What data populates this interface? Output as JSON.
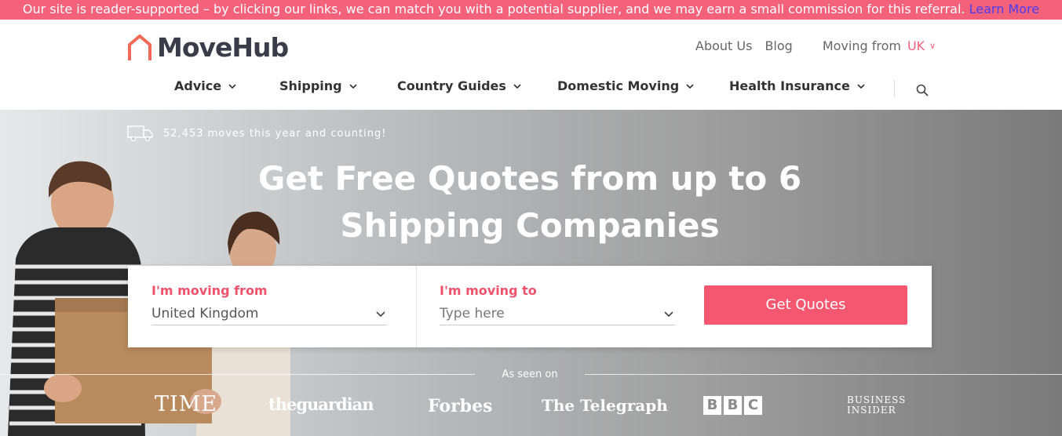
{
  "banner": {
    "text": "Our site is reader-supported – by clicking our links, we can match you with a potential supplier, and we may earn a small commission for this referral.",
    "link": "Learn More"
  },
  "header": {
    "logo_text": "MoveHub",
    "links": {
      "about": "About Us",
      "blog": "Blog",
      "moving_from_label": "Moving from",
      "moving_from_value": "UK"
    },
    "nav": [
      "Advice",
      "Shipping",
      "Country Guides",
      "Domestic Moving",
      "Health Insurance"
    ]
  },
  "hero": {
    "counter": "52,453 moves this year and counting!",
    "headline_line1": "Get Free Quotes from up to 6",
    "headline_line2": "Shipping Companies",
    "form": {
      "from_label": "I'm moving from",
      "from_value": "United Kingdom",
      "to_label": "I'm moving to",
      "to_placeholder": "Type here",
      "button": "Get Quotes"
    },
    "as_seen_on": "As seen on",
    "press": {
      "time": "TIME",
      "guardian": "theguardian",
      "forbes": "Forbes",
      "telegraph": "The Telegraph",
      "bbc": [
        "B",
        "B",
        "C"
      ],
      "business_insider_line1": "BUSINESS",
      "business_insider_line2": "INSIDER"
    }
  },
  "colors": {
    "accent": "#f4617a",
    "link": "#4a3cf0",
    "button": "#f4576f"
  }
}
